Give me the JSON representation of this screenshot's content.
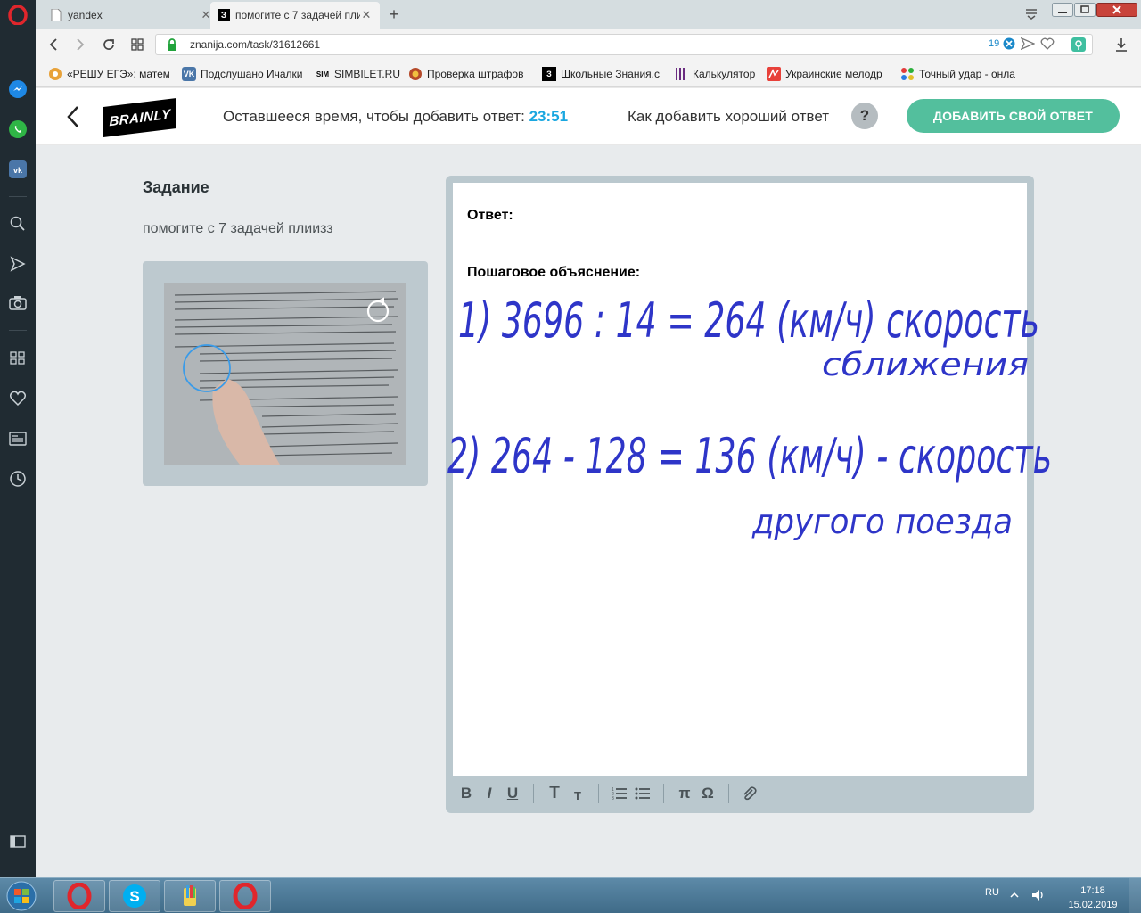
{
  "browser": {
    "tabs": [
      {
        "label": "yandex",
        "active": false
      },
      {
        "label": "помогите с 7 задачей пли",
        "active": true
      }
    ],
    "url": "znanija.com/task/31612661",
    "badge_count": "19",
    "bookmarks": [
      {
        "label": "«РЕШУ ЕГЭ»: матема",
        "icon": "reshu-ege-icon"
      },
      {
        "label": "Подслушано Ичалки",
        "icon": "vk-icon"
      },
      {
        "label": "SIMBILET.RU",
        "icon": "simbilet-icon"
      },
      {
        "label": "Проверка штрафов",
        "icon": "police-icon"
      },
      {
        "label": "Школьные Знания.c",
        "icon": "znanija-icon"
      },
      {
        "label": "Калькулятор",
        "icon": "calculator-icon"
      },
      {
        "label": "Украинские мелодр",
        "icon": "melodrama-icon"
      },
      {
        "label": "Точный удар - онла",
        "icon": "tochny-udar-icon"
      }
    ]
  },
  "header": {
    "logo": "BRAINLY",
    "time_label": "Оставшееся время, чтобы добавить ответ:",
    "time_value": "23:51",
    "how_label": "Как добавить хороший ответ",
    "help_symbol": "?",
    "add_button": "ДОБАВИТЬ СВОЙ ОТВЕТ"
  },
  "task": {
    "heading": "Задание",
    "text": "помогите с 7 задачей плиизз"
  },
  "editor": {
    "answer_label": "Ответ:",
    "explanation_label": "Пошаговое объяснение:",
    "toolbar": {
      "bold": "B",
      "italic": "I",
      "underline": "U",
      "text_large": "T",
      "text_small": "T",
      "pi": "π",
      "omega": "Ω"
    },
    "handwriting": {
      "line1": "1) 3696 : 14 = 264 (км/ч) скорость",
      "line1b": "сближения",
      "line2": "2) 264 - 128 = 136 (км/ч) - скорость",
      "line2b": "другого поезда",
      "color": "#2e35c8"
    }
  },
  "taskbar": {
    "lang": "RU",
    "time": "17:18",
    "date": "15.02.2019"
  },
  "colors": {
    "brand_green": "#53bf9d",
    "timer_blue": "#1aa7e0",
    "sidebar_dark": "#202b32"
  }
}
